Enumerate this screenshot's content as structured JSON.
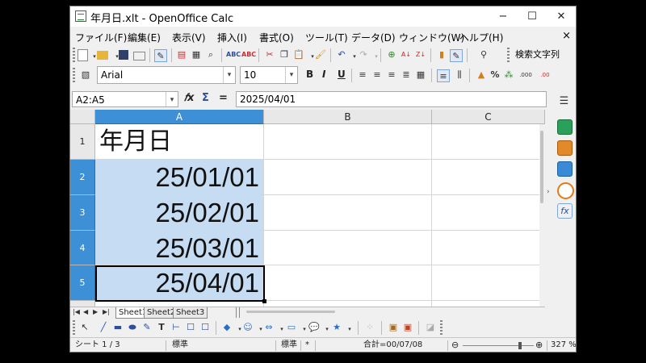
{
  "window": {
    "title": "年月日.xlt - OpenOffice Calc",
    "minimize": "−",
    "maximize": "☐",
    "close": "✕"
  },
  "menu": [
    {
      "label": "ファイル(F)"
    },
    {
      "label": "編集(E)"
    },
    {
      "label": "表示(V)"
    },
    {
      "label": "挿入(I)"
    },
    {
      "label": "書式(O)"
    },
    {
      "label": "ツール(T)"
    },
    {
      "label": "データ(D)"
    },
    {
      "label": "ウィンドウ(W)"
    },
    {
      "label": "ヘルプ(H)"
    }
  ],
  "menu_close": "×",
  "toolbar": {
    "search_label": "検索文字列"
  },
  "format": {
    "font_name": "Arial",
    "font_size": "10",
    "bold": "B",
    "italic": "I",
    "underline": "U",
    "percent": "%",
    "dec_add": ".000",
    "dec_remove": ".00"
  },
  "formula_bar": {
    "name_box": "A2:A5",
    "value": "2025/04/01",
    "fx": "𝑓x",
    "sum": "Σ",
    "equals": "="
  },
  "sheet": {
    "columns": [
      "A",
      "B",
      "C"
    ],
    "rows": [
      "1",
      "2",
      "3",
      "4",
      "5"
    ],
    "cells": {
      "A1": "年月日",
      "A2": "25/01/01",
      "A3": "25/02/01",
      "A4": "25/03/01",
      "A5": "25/04/01"
    }
  },
  "tabs": [
    "Sheet1",
    "Sheet2",
    "Sheet3"
  ],
  "status": {
    "sheet": "シート 1 / 3",
    "style": "標準",
    "mode": "標準",
    "mode_flag": "*",
    "sum": "合計=00/07/08",
    "zoom": "327 %"
  },
  "colors": {
    "selection_header": "#3d8fd6",
    "selection_fill": "#c5dcf2"
  }
}
